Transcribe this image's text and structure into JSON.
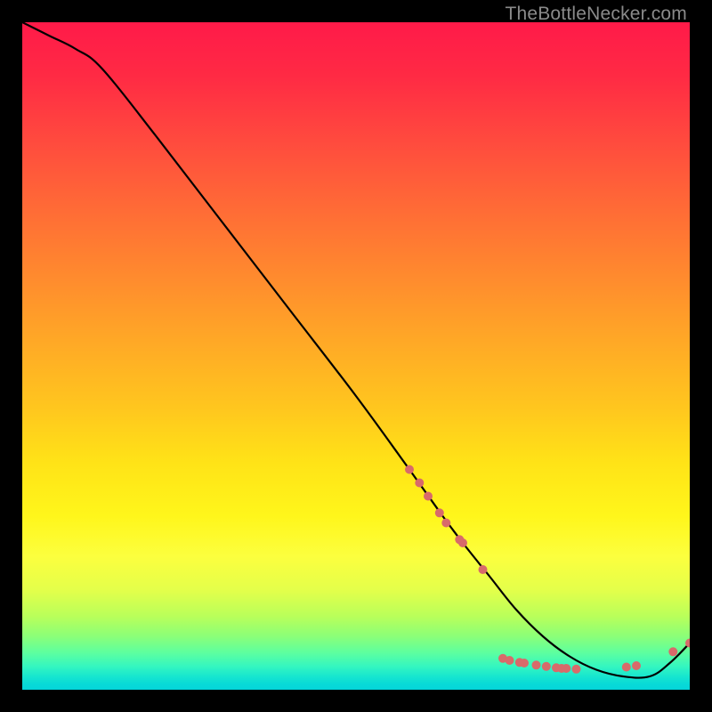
{
  "watermark": "TheBottleNecker.com",
  "chart_data": {
    "type": "line",
    "title": "",
    "xlabel": "",
    "ylabel": "",
    "xlim": [
      0,
      100
    ],
    "ylim": [
      0,
      100
    ],
    "background_gradient": {
      "direction": "top-to-bottom",
      "stops": [
        {
          "pos": 0,
          "color": "#ff1a49"
        },
        {
          "pos": 18,
          "color": "#ff4b3e"
        },
        {
          "pos": 38,
          "color": "#ff8a2e"
        },
        {
          "pos": 58,
          "color": "#ffc71e"
        },
        {
          "pos": 74,
          "color": "#fff61b"
        },
        {
          "pos": 89,
          "color": "#b9ff5a"
        },
        {
          "pos": 96,
          "color": "#34f6c0"
        },
        {
          "pos": 100,
          "color": "#04d5da"
        }
      ]
    },
    "series": [
      {
        "name": "bottleneck-curve",
        "color": "#000000",
        "x": [
          0,
          4,
          8,
          12,
          20,
          30,
          40,
          50,
          58,
          63,
          66,
          70,
          74,
          78,
          82,
          86,
          90,
          94,
          97,
          100
        ],
        "y": [
          100,
          98,
          96,
          93,
          83,
          70,
          57,
          44,
          33,
          26,
          22,
          17,
          12,
          8,
          5,
          3,
          2,
          2,
          4,
          7
        ]
      }
    ],
    "markers": [
      {
        "name": "highlight-points",
        "color": "#d86a6a",
        "radius_px": 5,
        "points": [
          {
            "x": 58.0,
            "y": 33.0
          },
          {
            "x": 59.5,
            "y": 31.0
          },
          {
            "x": 60.8,
            "y": 29.0
          },
          {
            "x": 62.5,
            "y": 26.5
          },
          {
            "x": 63.5,
            "y": 25.0
          },
          {
            "x": 65.5,
            "y": 22.5
          },
          {
            "x": 66.0,
            "y": 22.0
          },
          {
            "x": 69.0,
            "y": 18.0
          },
          {
            "x": 72.0,
            "y": 4.7
          },
          {
            "x": 73.0,
            "y": 4.4
          },
          {
            "x": 74.5,
            "y": 4.1
          },
          {
            "x": 75.2,
            "y": 4.0
          },
          {
            "x": 77.0,
            "y": 3.7
          },
          {
            "x": 78.5,
            "y": 3.5
          },
          {
            "x": 80.0,
            "y": 3.3
          },
          {
            "x": 80.8,
            "y": 3.2
          },
          {
            "x": 81.5,
            "y": 3.2
          },
          {
            "x": 83.0,
            "y": 3.1
          },
          {
            "x": 90.5,
            "y": 3.4
          },
          {
            "x": 92.0,
            "y": 3.6
          },
          {
            "x": 97.5,
            "y": 5.7
          },
          {
            "x": 100.0,
            "y": 7.0
          }
        ]
      }
    ]
  }
}
